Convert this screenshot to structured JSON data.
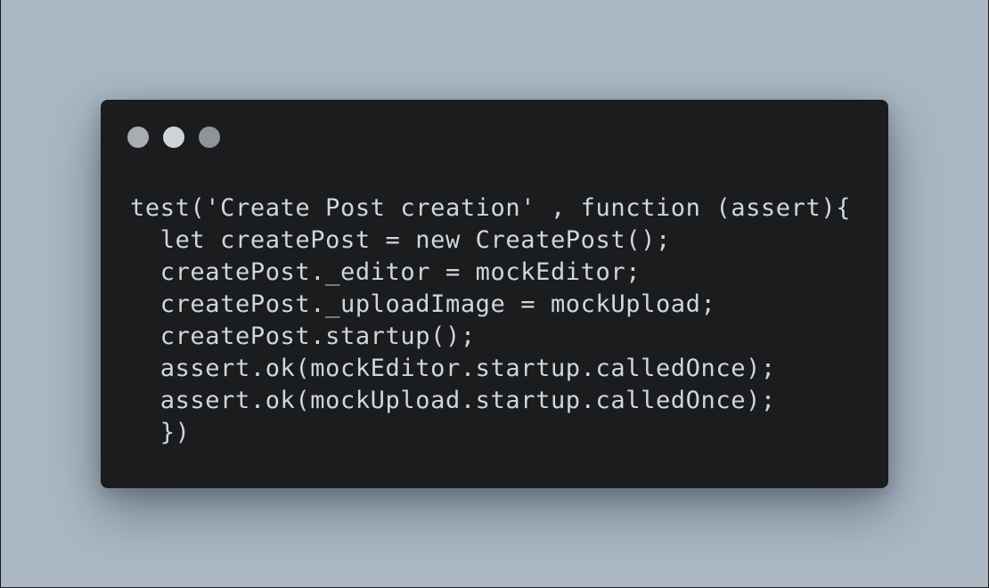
{
  "window": {
    "controls": [
      {
        "name": "close",
        "color": "#a9adb2"
      },
      {
        "name": "minimize",
        "color": "#d0d3d7"
      },
      {
        "name": "maximize",
        "color": "#8f949a"
      }
    ]
  },
  "code": {
    "language": "javascript",
    "lines": [
      "test('Create Post creation' , function (assert){",
      "  let createPost = new CreatePost();",
      "  createPost._editor = mockEditor;",
      "  createPost._uploadImage = mockUpload;",
      "  createPost.startup();",
      "  assert.ok(mockEditor.startup.calledOnce);",
      "  assert.ok(mockUpload.startup.calledOnce);",
      "  })"
    ]
  }
}
